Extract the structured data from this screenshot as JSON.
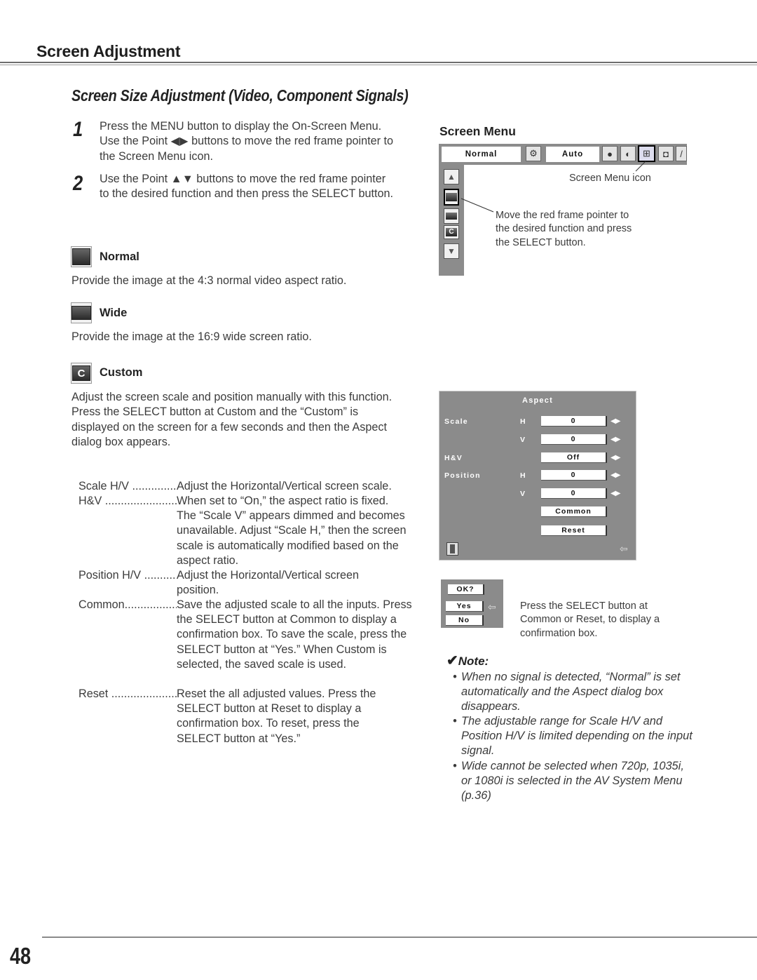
{
  "header": {
    "section_title": "Screen Adjustment",
    "subtitle": "Screen Size Adjustment (Video, Component Signals)"
  },
  "steps": [
    {
      "number": "1",
      "text": "Press the MENU button to display the On-Screen Menu. Use the Point ◀▶ buttons to move the red frame pointer to the Screen Menu icon."
    },
    {
      "number": "2",
      "text": "Use the Point ▲▼ buttons to move the red frame pointer to the desired function and then press the SELECT button."
    }
  ],
  "modes": [
    {
      "icon": "normal-screen-icon",
      "label": "Normal",
      "description": "Provide the image at the 4:3 normal video aspect ratio."
    },
    {
      "icon": "wide-screen-icon",
      "label": "Wide",
      "description": "Provide the image at the 16:9 wide screen ratio."
    },
    {
      "icon": "custom-screen-icon",
      "label": "Custom",
      "icon_glyph": "C",
      "description": "Adjust the screen scale and position manually with this function.\nPress the SELECT button at Custom and the “Custom” is displayed on the screen for a few seconds and then the Aspect dialog box appears."
    }
  ],
  "custom_terms": [
    {
      "term": "Scale H/V ........................",
      "definition": "Adjust the Horizontal/Vertical screen scale."
    },
    {
      "term": "H&V ..................................",
      "definition": "When set to “On,” the aspect ratio is fixed. The “Scale V” appears dimmed and becomes unavailable. Adjust “Scale H,” then the screen scale is automatically modified based on the aspect ratio."
    },
    {
      "term": "Position H/V ......................",
      "definition": "Adjust the Horizontal/Vertical screen position."
    },
    {
      "term": "Common...............................",
      "definition": "Save the adjusted scale to all the inputs. Press the SELECT button at Common to display a confirmation box. To save the scale, press the SELECT button at “Yes.” When Custom is selected, the saved scale is used."
    },
    {
      "term": "Reset .................................",
      "definition": "Reset the all adjusted values. Press the SELECT button at Reset to display a confirmation box. To reset, press the SELECT button at “Yes.”"
    }
  ],
  "screen_menu": {
    "title": "Screen Menu",
    "menubar": {
      "mode_value": "Normal",
      "auto_value": "Auto",
      "icons": [
        "pc-adjust-icon",
        "image-select-icon",
        "image-adjust-icon",
        "screen-menu-icon",
        "sound-icon",
        "setting-icon"
      ]
    },
    "sidebar_buttons": [
      "up-arrow-icon",
      "normal-screen-icon",
      "wide-screen-icon",
      "custom-screen-icon",
      "down-arrow-icon"
    ],
    "callout_icon": "Screen Menu icon",
    "callout_pointer": "Move the red frame pointer to the desired function and press the SELECT button."
  },
  "aspect_dialog": {
    "title": "Aspect",
    "rows": [
      {
        "label": "Scale",
        "axis": "H",
        "value": "0"
      },
      {
        "label": "",
        "axis": "V",
        "value": "0"
      },
      {
        "label": "H&V",
        "axis": "",
        "value": "Off"
      },
      {
        "label": "Position",
        "axis": "H",
        "value": "0"
      },
      {
        "label": "",
        "axis": "V",
        "value": "0"
      }
    ],
    "buttons": [
      "Common",
      "Reset"
    ],
    "arrows": "◀▶",
    "back_arrow": "⇦"
  },
  "confirm_dialog": {
    "title": "OK?",
    "yes": "Yes",
    "no": "No",
    "pointer": "⇦",
    "caption": "Press the SELECT button at Common or Reset, to display a confirmation box."
  },
  "note": {
    "check": "✔",
    "heading": "Note:",
    "items": [
      "When no signal is detected, “Normal” is set automatically and the Aspect dialog box disappears.",
      "The adjustable range for Scale H/V and Position H/V is limited depending on the input signal.",
      "Wide cannot be selected when 720p, 1035i, or 1080i is selected in the AV System Menu (p.36)"
    ]
  },
  "footer": {
    "page_number": "48"
  }
}
